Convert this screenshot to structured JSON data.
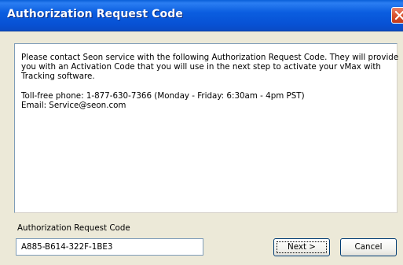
{
  "window": {
    "title": "Authorization Request Code"
  },
  "message": {
    "line1": "Please contact Seon service with the following Authorization Request Code.  They will provide",
    "line2": "you with an Activation Code that you will use in the next step to activate your vMax with",
    "line3": "Tracking software.",
    "phone": "Toll-free phone: 1-877-630-7366 (Monday - Friday: 6:30am - 4pm PST)",
    "email": "Email: Service@seon.com"
  },
  "form": {
    "code_label": "Authorization Request Code",
    "code_value": "A885-B614-322F-1BE3"
  },
  "buttons": {
    "next_label": "Next >",
    "cancel_label": "Cancel"
  },
  "colors": {
    "titlebar": "#0b5ee0",
    "close": "#d9532d",
    "dialog_bg": "#ece9d8"
  },
  "icons": {
    "close": "close-icon"
  }
}
